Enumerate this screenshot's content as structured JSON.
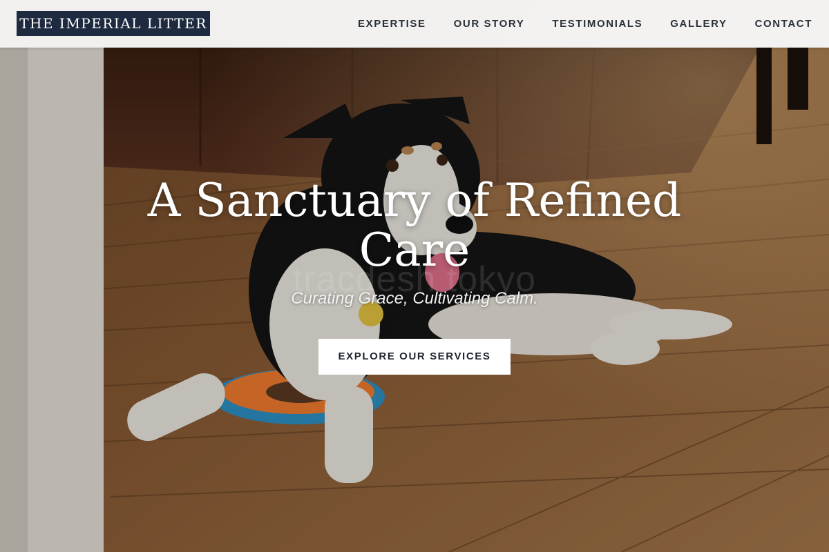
{
  "header": {
    "logo_text": "THE IMPERIAL LITTER",
    "nav": [
      {
        "label": "EXPERTISE"
      },
      {
        "label": "OUR STORY"
      },
      {
        "label": "TESTIMONIALS"
      },
      {
        "label": "GALLERY"
      },
      {
        "label": "CONTACT"
      }
    ]
  },
  "hero": {
    "title": "A Sanctuary of Refined Care",
    "subtitle": "Curating Grace, Cultivating Calm.",
    "cta_label": "EXPLORE OUR SERVICES",
    "watermark": "tracdesh tokyo"
  },
  "colors": {
    "brand_navy": "#1e2a40",
    "header_bg": "#f8f8f8",
    "nav_text": "#2a2f38",
    "cta_bg": "#ffffff"
  }
}
